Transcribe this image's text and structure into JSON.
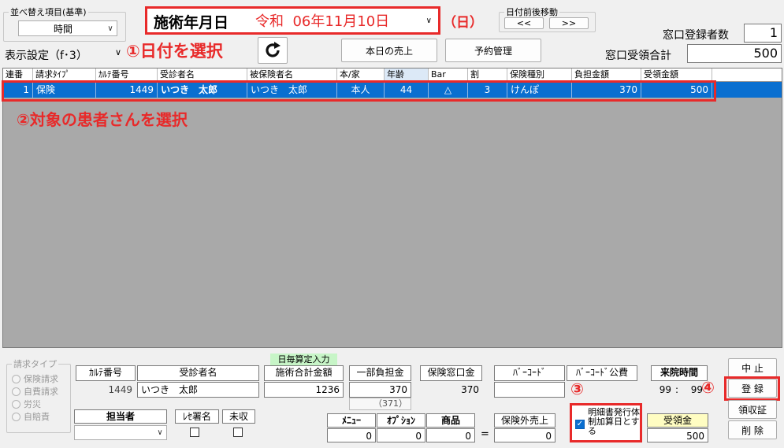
{
  "sort": {
    "label": "並べ替え項目(基準)",
    "value": "時間"
  },
  "display": {
    "label": "表示設定（f･3）"
  },
  "date": {
    "label": "施術年月日",
    "value": "令和  06年11月10日",
    "weekday": "（日）"
  },
  "datenav": {
    "label": "日付前後移動",
    "prev": "<<",
    "next": ">>"
  },
  "annotations": {
    "step1": "①日付を選択",
    "step2": "②対象の患者さんを選択",
    "step3": "③",
    "step4": "④"
  },
  "buttons": {
    "today_sales": "本日の売上",
    "reservation": "予約管理",
    "cancel": "中 止",
    "register": "登 録",
    "receipt": "領収証",
    "delete": "削 除"
  },
  "summary": {
    "registered_label": "窓口登録者数",
    "registered_value": "1",
    "total_label": "窓口受領合計",
    "total_value": "500"
  },
  "grid": {
    "columns": [
      "連番",
      "請求ﾀｲﾌﾟ",
      "ｶﾙﾃ番号",
      "受診者名",
      "被保険者名",
      "本/家",
      "年齢",
      "Bar",
      "割",
      "保険種別",
      "負担金額",
      "受領金額"
    ],
    "rows": [
      [
        "1",
        "保険",
        "1449",
        "いつき　太郎",
        "いつき　太郎",
        "本人",
        "44",
        "△",
        "3",
        "けんぽ",
        "370",
        "500"
      ]
    ]
  },
  "bottom": {
    "claim_type_label": "請求タイプ",
    "claim_types": [
      "保険請求",
      "自費請求",
      "労災",
      "自賠責"
    ],
    "chart_no_label": "ｶﾙﾃ番号",
    "chart_no_value": "1449",
    "patient_label": "受診者名",
    "patient_value": "いつき　太郎",
    "daily_calc": "日毎算定入力",
    "total_label": "施術合計金額",
    "total_value": "1236",
    "partial_label": "一部負担金",
    "partial_value": "370",
    "partial_sub": "（371）",
    "window_label": "保険窓口金",
    "window_value": "370",
    "barcode_label": "ﾊﾞｰｺｰﾄﾞ",
    "barcode_pub_label": "ﾊﾞｰｺｰﾄﾞ公費",
    "visit_time_label": "来院時間",
    "visit_h": "99",
    "visit_sep": ":",
    "visit_m": "99",
    "staff_label": "担当者",
    "resign_label": "ﾚｾ署名",
    "unpaid_label": "未収",
    "menu_label": "ﾒﾆｭｰ",
    "menu_value": "0",
    "option_label": "ｵﾌﾟｼｮﾝ",
    "option_value": "0",
    "product_label": "商品",
    "product_value": "0",
    "eq": "=",
    "outside_label": "保険外売上",
    "outside_value": "0",
    "detail_label": "明細書発行体制加算日とする",
    "received_label": "受領金",
    "received_value": "500"
  }
}
